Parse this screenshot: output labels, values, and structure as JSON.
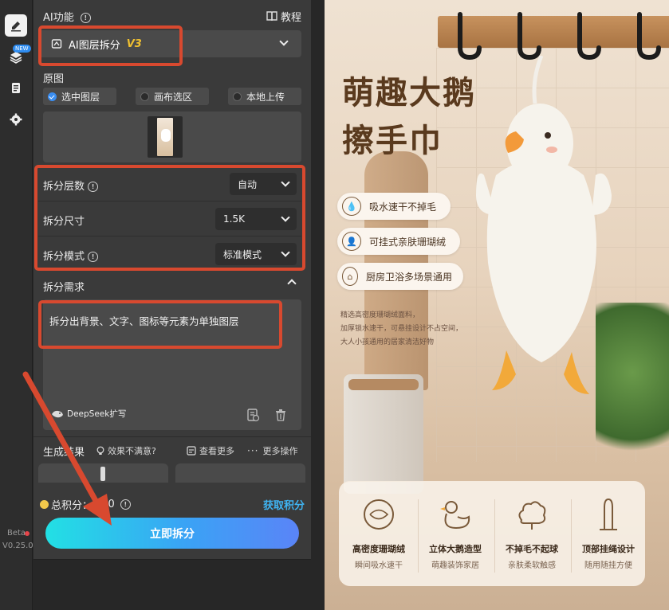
{
  "left_rail": {
    "new_badge": "NEW",
    "beta": "Beta",
    "version": "V0.25.0"
  },
  "panel": {
    "section_title": "AI功能",
    "tutorial": "教程",
    "feature_select": {
      "value": "AI图层拆分",
      "version_tag": "V3"
    },
    "source_label": "原图",
    "source_options": [
      {
        "label": "选中图层",
        "selected": true
      },
      {
        "label": "画布选区",
        "selected": false
      },
      {
        "label": "本地上传",
        "selected": false
      }
    ],
    "layer_count": {
      "label": "拆分层数",
      "value": "自动"
    },
    "size": {
      "label": "拆分尺寸",
      "value": "1.5K"
    },
    "mode": {
      "label": "拆分模式",
      "value": "标准模式"
    },
    "requirements": {
      "label": "拆分需求",
      "text": "拆分出背景、文字、图标等元素为单独图层",
      "deepseek": "DeepSeek扩写"
    },
    "results": {
      "label": "生成结果",
      "unsatisfied": "效果不满意?",
      "view_more": "查看更多",
      "more_actions": "更多操作"
    },
    "points": {
      "label": "总积分：",
      "value": "500",
      "get": "获取积分"
    },
    "primary_button": "立即拆分"
  },
  "preview": {
    "title_line1": "萌趣大鹅",
    "title_line2": "擦手巾",
    "pills": [
      "吸水速干不掉毛",
      "可挂式亲肤珊瑚绒",
      "厨房卫浴多场景通用"
    ],
    "desc_lines": [
      "精选高密度珊瑚绒面料，",
      "加厚锁水速干，可悬挂设计不占空间，",
      "大人小孩通用的居家清洁好物"
    ],
    "features": [
      {
        "title": "高密度珊瑚绒",
        "sub": "瞬间吸水速干"
      },
      {
        "title": "立体大鹅造型",
        "sub": "萌趣装饰家居"
      },
      {
        "title": "不掉毛不起球",
        "sub": "亲肤柔软触感"
      },
      {
        "title": "顶部挂绳设计",
        "sub": "随用随挂方便"
      }
    ]
  },
  "colors": {
    "accent": "#d8492f",
    "primary_gradient_start": "#22e0e4",
    "primary_gradient_end": "#5a84f7",
    "link": "#3fb4f2"
  }
}
